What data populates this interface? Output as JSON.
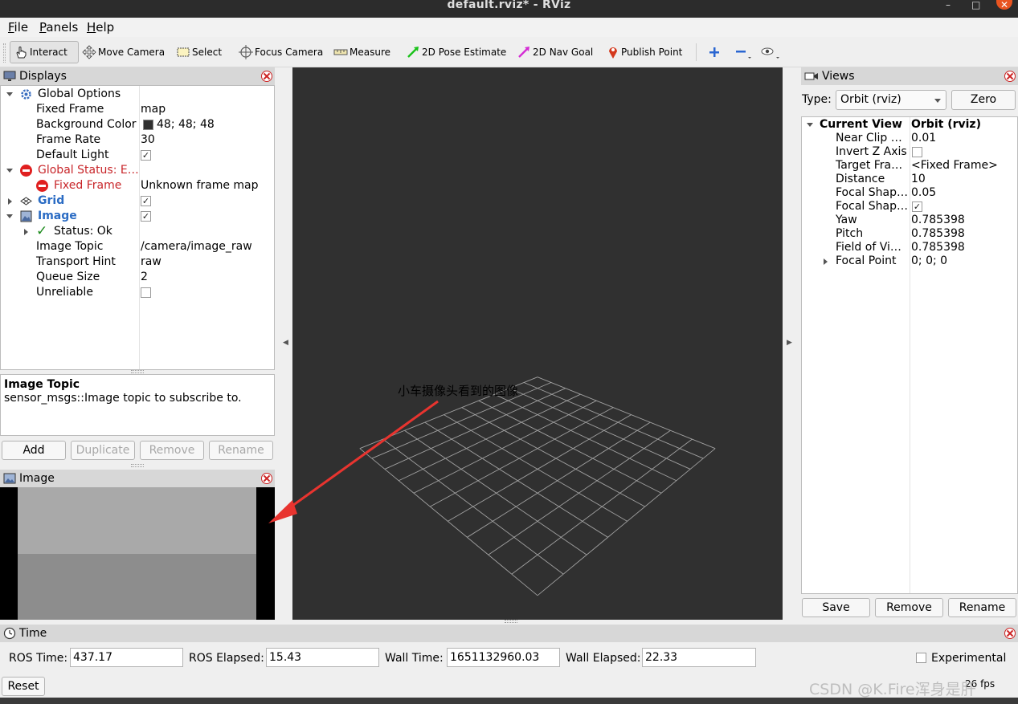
{
  "window": {
    "title": "default.rviz* - RViz",
    "controls": [
      "–",
      "□",
      "✕"
    ]
  },
  "menu": {
    "items": [
      {
        "label": "File",
        "accel": "F",
        "rest": "ile"
      },
      {
        "label": "Panels",
        "accel": "P",
        "rest": "anels"
      },
      {
        "label": "Help",
        "accel": "H",
        "rest": "elp"
      }
    ]
  },
  "toolbar": {
    "tools": [
      {
        "label": "Interact",
        "icon": "hand-pointer-icon",
        "active": true
      },
      {
        "label": "Move Camera",
        "icon": "move-arrows-icon",
        "active": false
      },
      {
        "label": "Select",
        "icon": "select-box-icon",
        "active": false
      },
      {
        "label": "Focus Camera",
        "icon": "crosshair-icon",
        "active": false
      },
      {
        "label": "Measure",
        "icon": "ruler-icon",
        "active": false
      },
      {
        "label": "2D Pose Estimate",
        "icon": "green-arrow-icon",
        "active": false
      },
      {
        "label": "2D Nav Goal",
        "icon": "magenta-arrow-icon",
        "active": false
      },
      {
        "label": "Publish Point",
        "icon": "map-pin-icon",
        "active": false
      }
    ],
    "extra_icons": [
      "plus-icon",
      "minus-icon",
      "eye-icon"
    ],
    "colors": {
      "pose": "#19c219",
      "nav": "#d42bd4",
      "pin": "#d4381c",
      "plus_minus": "#2a66d1"
    }
  },
  "displays": {
    "title": "Displays",
    "rows": [
      {
        "label": "Global Options",
        "value": "",
        "kind": "section"
      },
      {
        "label": "Fixed Frame",
        "value": "map"
      },
      {
        "label": "Background Color",
        "value": "48; 48; 48",
        "swatch": "#303030"
      },
      {
        "label": "Frame Rate",
        "value": "30"
      },
      {
        "label": "Default Light",
        "value": "",
        "check": true
      },
      {
        "label": "Global Status: E…",
        "value": "",
        "kind": "error"
      },
      {
        "label": "Fixed Frame",
        "value": "Unknown frame map",
        "kind": "error-child"
      },
      {
        "label": "Grid",
        "value": "",
        "check": true,
        "kind": "display"
      },
      {
        "label": "Image",
        "value": "",
        "check": true,
        "kind": "display"
      },
      {
        "label": "Status: Ok",
        "value": "",
        "kind": "ok"
      },
      {
        "label": "Image Topic",
        "value": "/camera/image_raw"
      },
      {
        "label": "Transport Hint",
        "value": "raw"
      },
      {
        "label": "Queue Size",
        "value": "2"
      },
      {
        "label": "Unreliable",
        "value": "",
        "check": false
      }
    ],
    "help_title": "Image Topic",
    "help_text": "sensor_msgs::Image topic to subscribe to.",
    "buttons": {
      "add": "Add",
      "duplicate": "Duplicate",
      "remove": "Remove",
      "rename": "Rename"
    }
  },
  "image_panel": {
    "title": "Image"
  },
  "annotation": {
    "text": "小车摄像头看到的图像",
    "color": "#e8342f"
  },
  "views": {
    "title": "Views",
    "type_label": "Type:",
    "type_value": "Orbit (rviz)",
    "zero_label": "Zero",
    "header_left": "Current View",
    "header_right": "Orbit (rviz)",
    "rows": [
      {
        "label": "Near Clip …",
        "value": "0.01"
      },
      {
        "label": "Invert Z Axis",
        "value": "",
        "check": false
      },
      {
        "label": "Target Fra…",
        "value": "<Fixed Frame>"
      },
      {
        "label": "Distance",
        "value": "10"
      },
      {
        "label": "Focal Shap…",
        "value": "0.05"
      },
      {
        "label": "Focal Shap…",
        "value": "",
        "check": true
      },
      {
        "label": "Yaw",
        "value": "0.785398"
      },
      {
        "label": "Pitch",
        "value": "0.785398"
      },
      {
        "label": "Field of Vi…",
        "value": "0.785398"
      },
      {
        "label": "Focal Point",
        "value": "0; 0; 0",
        "expandable": true
      }
    ],
    "buttons": {
      "save": "Save",
      "remove": "Remove",
      "rename": "Rename"
    }
  },
  "time": {
    "title": "Time",
    "ros_time_label": "ROS Time:",
    "ros_time": "437.17",
    "ros_elapsed_label": "ROS Elapsed:",
    "ros_elapsed": "15.43",
    "wall_time_label": "Wall Time:",
    "wall_time": "1651132960.03",
    "wall_elapsed_label": "Wall Elapsed:",
    "wall_elapsed": "22.33",
    "experimental_label": "Experimental",
    "reset_label": "Reset",
    "fps": "26 fps"
  },
  "watermark": "CSDN @K.Fire浑身是肝"
}
